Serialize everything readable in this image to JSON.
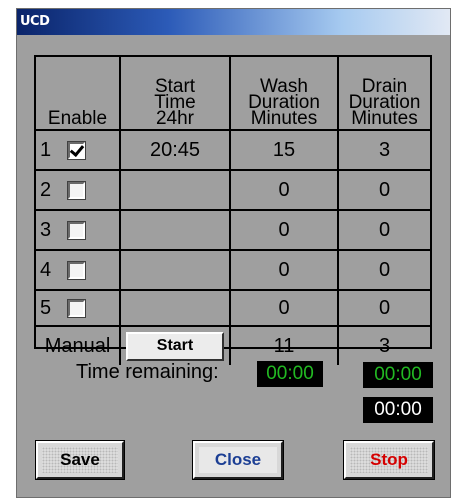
{
  "window": {
    "title": "UCD"
  },
  "table": {
    "headers": {
      "enable": "Enable",
      "start_time": "Start\nTime\n24hr",
      "wash": "Wash\nDuration\nMinutes",
      "drain": "Drain\nDuration\nMinutes"
    },
    "rows": [
      {
        "num": "1",
        "checked": true,
        "start": "20:45",
        "wash": "15",
        "drain": "3"
      },
      {
        "num": "2",
        "checked": false,
        "start": "",
        "wash": "0",
        "drain": "0"
      },
      {
        "num": "3",
        "checked": false,
        "start": "",
        "wash": "0",
        "drain": "0"
      },
      {
        "num": "4",
        "checked": false,
        "start": "",
        "wash": "0",
        "drain": "0"
      },
      {
        "num": "5",
        "checked": false,
        "start": "",
        "wash": "0",
        "drain": "0"
      }
    ],
    "manual": {
      "label": "Manual",
      "button": "Start",
      "wash": "11",
      "drain": "3"
    }
  },
  "time_remaining": {
    "label": "Time remaining:",
    "display1": "00:00",
    "display2": "00:00",
    "display3": "00:00"
  },
  "buttons": {
    "save": "Save",
    "close": "Close",
    "stop": "Stop"
  },
  "colors": {
    "lcd_green": "#22b922",
    "stop_red": "#d40000",
    "close_blue": "#1c3f94",
    "panel": "#9f9f9f"
  }
}
